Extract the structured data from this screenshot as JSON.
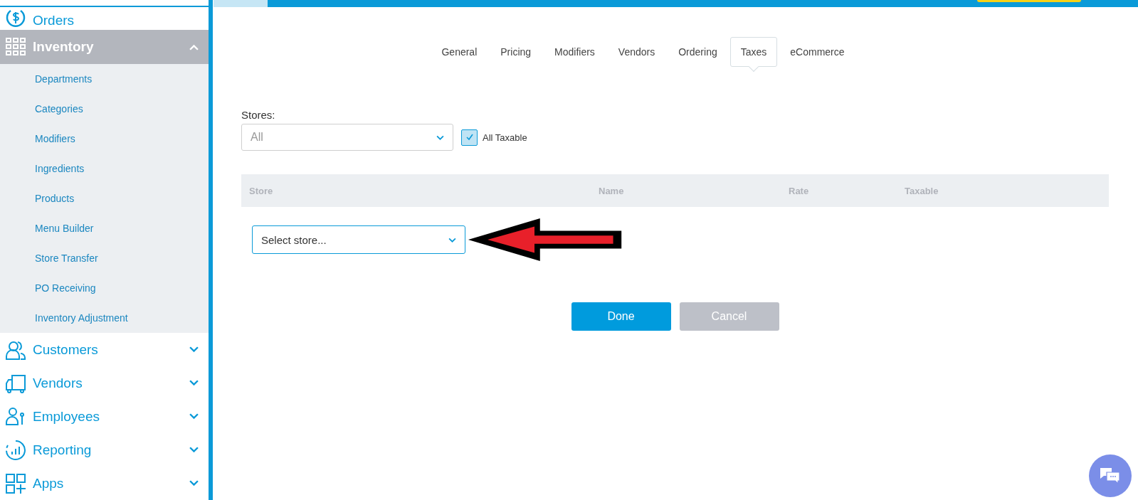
{
  "sidebar": {
    "items": [
      {
        "label": "Orders"
      },
      {
        "label": "Inventory",
        "expanded": true,
        "children": [
          {
            "label": "Departments"
          },
          {
            "label": "Categories"
          },
          {
            "label": "Modifiers"
          },
          {
            "label": "Ingredients"
          },
          {
            "label": "Products"
          },
          {
            "label": "Menu Builder"
          },
          {
            "label": "Store Transfer"
          },
          {
            "label": "PO Receiving"
          },
          {
            "label": "Inventory Adjustment"
          }
        ]
      },
      {
        "label": "Customers",
        "expanded": false
      },
      {
        "label": "Vendors",
        "expanded": false
      },
      {
        "label": "Employees",
        "expanded": false
      },
      {
        "label": "Reporting",
        "expanded": false
      },
      {
        "label": "Apps",
        "expanded": false
      }
    ]
  },
  "tabs": [
    {
      "label": "General",
      "selected": false
    },
    {
      "label": "Pricing",
      "selected": false
    },
    {
      "label": "Modifiers",
      "selected": false
    },
    {
      "label": "Vendors",
      "selected": false
    },
    {
      "label": "Ordering",
      "selected": false
    },
    {
      "label": "Taxes",
      "selected": true
    },
    {
      "label": "eCommerce",
      "selected": false
    }
  ],
  "stores": {
    "label": "Stores:",
    "value": "All"
  },
  "all_taxable": {
    "label": "All Taxable",
    "checked": true
  },
  "table": {
    "columns": [
      "Store",
      "Name",
      "Rate",
      "Taxable"
    ],
    "row_select": {
      "placeholder": "Select store..."
    }
  },
  "buttons": [
    {
      "label": "Done",
      "kind": "primary"
    },
    {
      "label": "Cancel",
      "kind": "secondary"
    }
  ]
}
